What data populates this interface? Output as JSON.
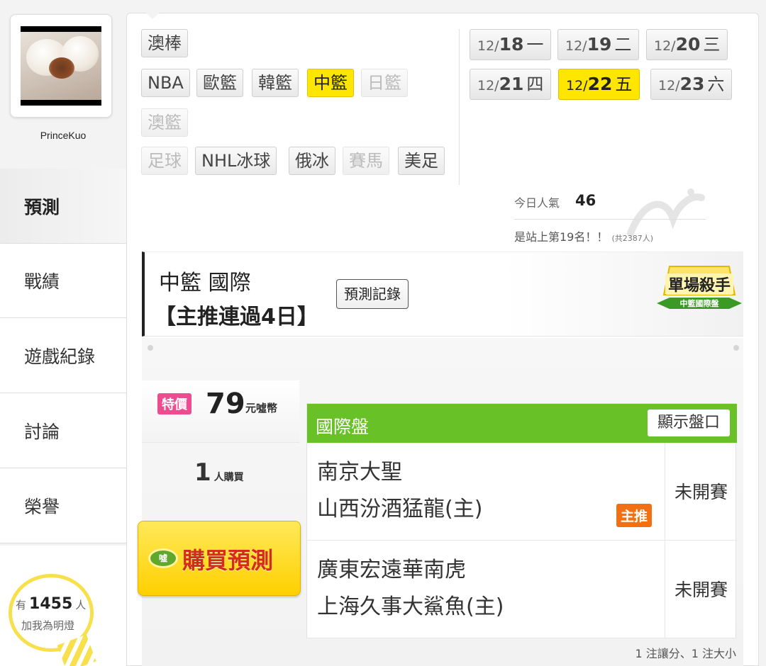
{
  "user": {
    "name": "PrinceKuo"
  },
  "nav": {
    "items": [
      {
        "label": "預測",
        "active": true
      },
      {
        "label": "戰績"
      },
      {
        "label": "遊戲紀錄"
      },
      {
        "label": "討論"
      },
      {
        "label": "榮譽"
      }
    ]
  },
  "fans": {
    "prefix": "有",
    "count": "1455",
    "suffix": "人",
    "line2": "加我為明燈"
  },
  "sports": {
    "row1": [
      "澳棒"
    ],
    "row2": [
      "NBA",
      "歐籃",
      "韓籃",
      "中籃",
      "日籃"
    ],
    "row3": [
      "澳籃"
    ],
    "row4": [
      "足球",
      "NHL冰球",
      "俄冰",
      "賽馬",
      "美足"
    ],
    "active": "中籃",
    "disabled": [
      "日籃",
      "澳籃",
      "足球",
      "賽馬"
    ]
  },
  "dates": [
    {
      "md": "12/",
      "day": "18",
      "wd": "一"
    },
    {
      "md": "12/",
      "day": "19",
      "wd": "二"
    },
    {
      "md": "12/",
      "day": "20",
      "wd": "三"
    },
    {
      "md": "12/",
      "day": "21",
      "wd": "四"
    },
    {
      "md": "12/",
      "day": "22",
      "wd": "五",
      "active": true
    },
    {
      "md": "12/",
      "day": "23",
      "wd": "六"
    }
  ],
  "popularity": {
    "label": "今日人氣",
    "value": "46",
    "rank_text": "是站上第19名！！",
    "total_text": "(共2387人)"
  },
  "prediction": {
    "title_line1": "中籃 國際",
    "title_line2": "【主推連過4日】",
    "record_button": "預測記錄",
    "badge_main": "單場殺手",
    "badge_sub": "中籃國際盤"
  },
  "purchase": {
    "special_label": "特價",
    "price": "79",
    "currency": "元噓幣",
    "buyers": "1",
    "buyers_suffix": "人購買",
    "buy_button": "購買預測",
    "coin_label": "噓"
  },
  "market": {
    "title": "國際盤",
    "show_button": "顯示盤口",
    "games": [
      {
        "away": "南京大聖",
        "home": "山西汾酒猛龍(主)",
        "status": "未開賽",
        "pick_label": "主推"
      },
      {
        "away": "廣東宏遠華南虎",
        "home": "上海久事大鯊魚(主)",
        "status": "未開賽"
      }
    ],
    "footnote": "1 注讓分、1 注大小"
  },
  "colors": {
    "accent_yellow": "#ffe600",
    "market_green": "#69c128",
    "special_pink": "#ec4c90",
    "pick_orange": "#f27012"
  }
}
